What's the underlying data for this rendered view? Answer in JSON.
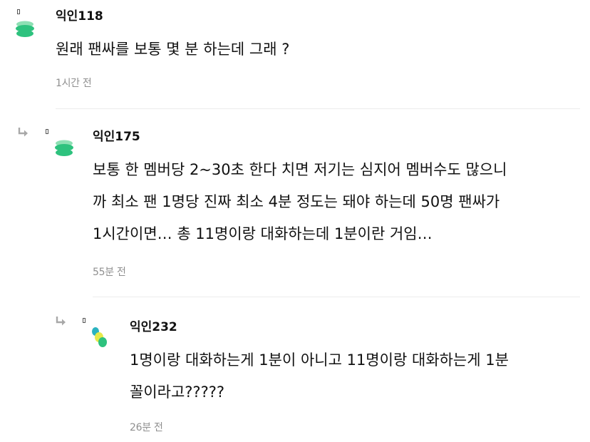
{
  "comments": [
    {
      "author": "익인118",
      "lines": [
        "원래 팬싸를 보통 몇 분 하는데 그래 ?"
      ],
      "time": "1시간 전"
    },
    {
      "author": "익인175",
      "lines": [
        "보통 한 멤버당 2~30초 한다 치면 저기는 심지어 멤버수도 많으니",
        "까 최소 팬 1명당 진짜 최소 4분 정도는 돼야 하는데 50명 팬싸가",
        "1시간이면… 총 11명이랑 대화하는데 1분이란 거임…"
      ],
      "time": "55분 전"
    },
    {
      "author": "익인232",
      "lines": [
        "1명이랑 대화하는게 1분이 아니고 11명이랑 대화하는게 1분",
        "꼴이라고?????"
      ],
      "time": "26분 전"
    }
  ],
  "icons": {
    "reply": "reply-arrow-icon",
    "avatar_1": "green-stack-avatar-icon",
    "avatar_2": "green-stack-avatar-icon",
    "avatar_3": "colorful-dots-avatar-icon"
  },
  "colors": {
    "avatar_green": "#2ec27e",
    "avatar_green_light": "#8ee0b4",
    "avatar_teal": "#2bb3c0",
    "avatar_yellow": "#e7e94a",
    "time_text": "#8f8f8f",
    "divider": "#ececec"
  }
}
